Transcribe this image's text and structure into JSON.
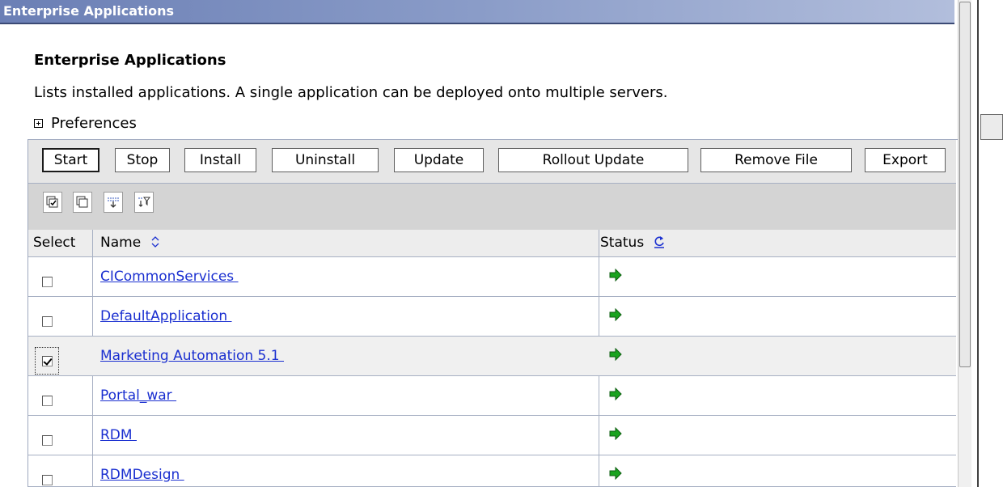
{
  "header": {
    "title": "Enterprise Applications"
  },
  "content": {
    "heading": "Enterprise Applications",
    "description": "Lists installed applications. A single application can be deployed onto multiple servers.",
    "preferences_label": "Preferences"
  },
  "toolbar": {
    "buttons": [
      "Start",
      "Stop",
      "Install",
      "Uninstall",
      "Update",
      "Rollout Update",
      "Remove File",
      "Export"
    ]
  },
  "icon_toolbar": {
    "icons": [
      "select-all-icon",
      "deselect-all-icon",
      "expand-all-icon",
      "filter-icon"
    ]
  },
  "table": {
    "columns": {
      "select": "Select",
      "name": "Name",
      "status": "Status"
    },
    "rows": [
      {
        "name": "CICommonServices ",
        "checked": false,
        "status": "started"
      },
      {
        "name": "DefaultApplication ",
        "checked": false,
        "status": "started"
      },
      {
        "name": "Marketing Automation 5.1 ",
        "checked": true,
        "status": "started"
      },
      {
        "name": "Portal_war ",
        "checked": false,
        "status": "started"
      },
      {
        "name": "RDM ",
        "checked": false,
        "status": "started"
      },
      {
        "name": "RDMDesign ",
        "checked": false,
        "status": "started"
      }
    ]
  },
  "colors": {
    "link": "#1a2fd0",
    "status_green": "#19a31e",
    "title_bar": "#6b7fb5"
  }
}
